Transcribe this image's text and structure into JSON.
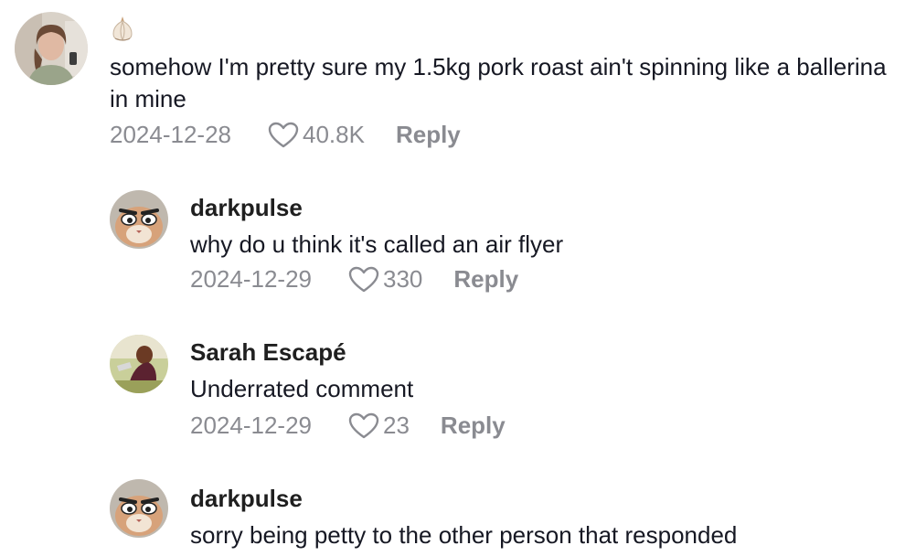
{
  "comments": [
    {
      "username": "",
      "emoji": "garlic",
      "text": "somehow I'm pretty sure my 1.5kg pork roast ain't spinning like a ballerina in mine",
      "date": "2024-12-28",
      "likes": "40.8K",
      "reply_label": "Reply"
    },
    {
      "username": "darkpulse",
      "text": "why do u think it's called an air flyer",
      "date": "2024-12-29",
      "likes": "330",
      "reply_label": "Reply"
    },
    {
      "username": "Sarah Escapé",
      "text": "Underrated comment",
      "date": "2024-12-29",
      "likes": "23",
      "reply_label": "Reply"
    },
    {
      "username": "darkpulse",
      "text": "sorry being petty to the other person that responded",
      "date": "",
      "likes": "",
      "reply_label": ""
    }
  ],
  "icons": {
    "like": "heart-outline-icon",
    "emoji": "garlic-emoji-icon"
  },
  "colors": {
    "meta_text": "#8a8b91",
    "primary_text": "#161823"
  }
}
